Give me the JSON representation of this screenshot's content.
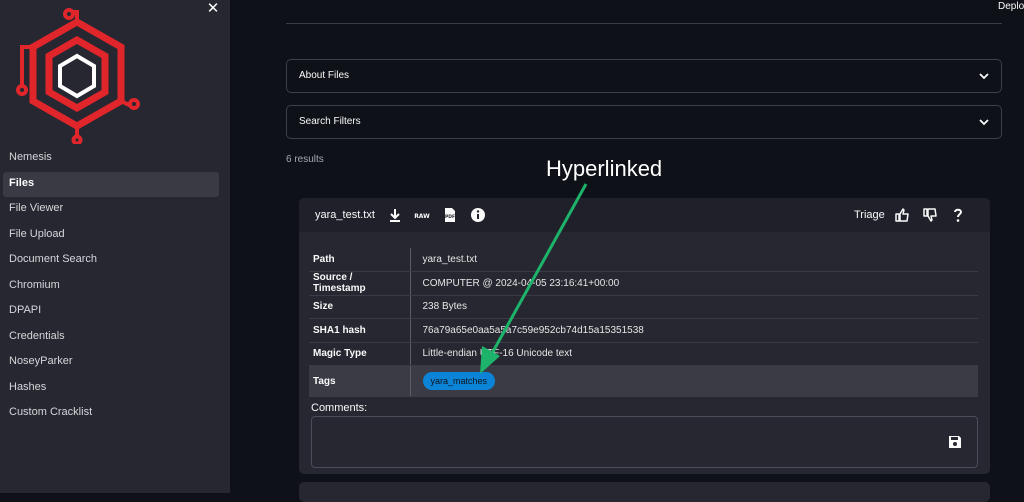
{
  "sidebar": {
    "close_glyph": "✕",
    "items": [
      {
        "label": "Nemesis"
      },
      {
        "label": "Files",
        "active": true
      },
      {
        "label": "File Viewer"
      },
      {
        "label": "File Upload"
      },
      {
        "label": "Document Search"
      },
      {
        "label": "Chromium"
      },
      {
        "label": "DPAPI"
      },
      {
        "label": "Credentials"
      },
      {
        "label": "NoseyParker"
      },
      {
        "label": "Hashes"
      },
      {
        "label": "Custom Cracklist"
      }
    ]
  },
  "header": {
    "deploy_label": "Deploy"
  },
  "expanders": [
    {
      "label": "About Files"
    },
    {
      "label": "Search Filters"
    }
  ],
  "results_text": "6 results",
  "annotation": {
    "text": "Hyperlinked",
    "color": "#1db36a"
  },
  "card": {
    "title": "yara_test.txt",
    "icons": [
      "download-icon",
      "raw-icon",
      "pdf-icon",
      "info-icon"
    ],
    "triage_label": "Triage",
    "triage_icons": [
      "thumbs-up-icon",
      "thumbs-down-icon",
      "question-icon"
    ],
    "rows": [
      {
        "key": "Path",
        "value": "yara_test.txt"
      },
      {
        "key": "Source / Timestamp",
        "value": "COMPUTER @ 2024-04-05 23:16:41+00:00"
      },
      {
        "key": "Size",
        "value": "238 Bytes"
      },
      {
        "key": "SHA1 hash",
        "value": "76a79a65e0aa5a5a7c59e952cb74d15a15351538"
      },
      {
        "key": "Magic Type",
        "value": "Little-endian UTF-16 Unicode text"
      }
    ],
    "tags_key": "Tags",
    "tags": [
      "yara_matches"
    ],
    "comments_label": "Comments:",
    "comments_value": "",
    "raw_text": "RAW",
    "pdf_text": "PDF"
  },
  "colors": {
    "accent": "#0b84d8",
    "logo_red": "#e0262b"
  }
}
